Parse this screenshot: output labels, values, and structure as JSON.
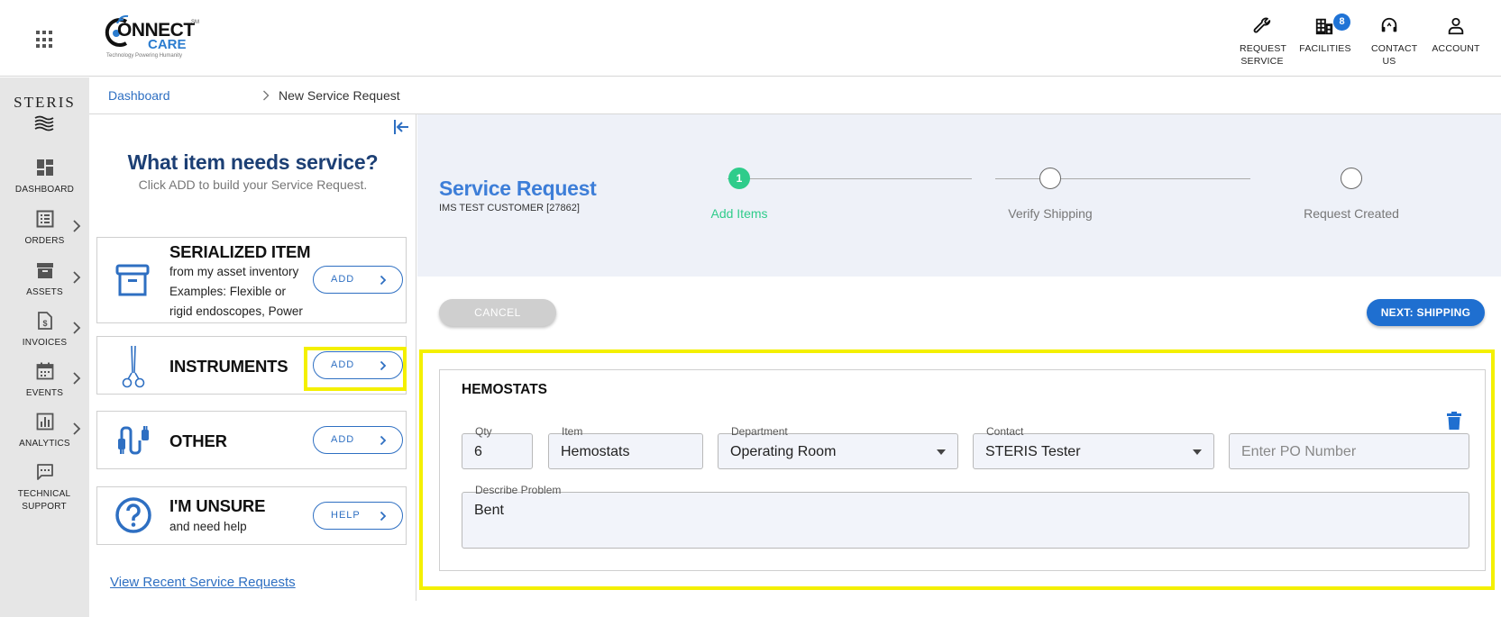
{
  "header": {
    "logo": {
      "word1": "ONNECT",
      "word2": "CARE",
      "mark": "SM",
      "tagline": "Technology Powering Humanity"
    },
    "nav": [
      {
        "label": "REQUEST SERVICE",
        "icon": "wrench-icon"
      },
      {
        "label": "FACILITIES",
        "icon": "building-icon",
        "badge": "8"
      },
      {
        "label": "CONTACT US",
        "icon": "headset-icon"
      },
      {
        "label": "ACCOUNT",
        "icon": "person-icon"
      }
    ]
  },
  "sidebar": {
    "brand": "STERIS",
    "items": [
      {
        "label": "DASHBOARD",
        "icon": "dashboard-icon",
        "has_arrow": false
      },
      {
        "label": "ORDERS",
        "icon": "orders-icon",
        "has_arrow": true
      },
      {
        "label": "ASSETS",
        "icon": "archive-icon",
        "has_arrow": true
      },
      {
        "label": "INVOICES",
        "icon": "invoice-icon",
        "has_arrow": true
      },
      {
        "label": "EVENTS",
        "icon": "calendar-icon",
        "has_arrow": true
      },
      {
        "label": "ANALYTICS",
        "icon": "analytics-icon",
        "has_arrow": true
      },
      {
        "label": "TECHNICAL SUPPORT",
        "icon": "chat-icon",
        "has_arrow": false
      }
    ]
  },
  "breadcrumb": {
    "root": "Dashboard",
    "current": "New Service Request"
  },
  "item_panel": {
    "title": "What item needs service?",
    "subtitle": "Click ADD to build your Service Request.",
    "cards": [
      {
        "title": "SERIALIZED ITEM",
        "lines": [
          "from my asset inventory",
          "Examples: Flexible or",
          "rigid endoscopes, Power"
        ],
        "button": "ADD",
        "icon": "archive-box-icon"
      },
      {
        "title": "INSTRUMENTS",
        "lines": [],
        "button": "ADD",
        "icon": "hemostat-icon"
      },
      {
        "title": "OTHER",
        "lines": [],
        "button": "ADD",
        "icon": "cable-icon"
      },
      {
        "title": "I'M UNSURE",
        "lines": [
          "and need help"
        ],
        "button": "HELP",
        "icon": "question-icon"
      }
    ],
    "recent_link": "View Recent Service Requests"
  },
  "request": {
    "title": "Service Request",
    "customer": "IMS TEST CUSTOMER [27862]",
    "steps": [
      {
        "number": "1",
        "label": "Add Items",
        "active": true
      },
      {
        "number": "",
        "label": "Verify Shipping",
        "active": false
      },
      {
        "number": "",
        "label": "Request Created",
        "active": false
      }
    ],
    "cancel_label": "CANCEL",
    "next_label": "NEXT: SHIPPING"
  },
  "form": {
    "title": "HEMOSTATS",
    "qty": {
      "label": "Qty",
      "value": "6"
    },
    "item": {
      "label": "Item",
      "value": "Hemostats"
    },
    "department": {
      "label": "Department",
      "value": "Operating Room"
    },
    "contact": {
      "label": "Contact",
      "value": "STERIS Tester"
    },
    "po": {
      "placeholder": "Enter PO Number"
    },
    "problem": {
      "label": "Describe Problem",
      "value": "Bent"
    }
  },
  "colors": {
    "brand_blue": "#2e6fc2",
    "primary_button": "#1f6fd0",
    "step_active": "#2fcc8b",
    "highlight": "#f4f000",
    "title_navy": "#1c3f74"
  }
}
